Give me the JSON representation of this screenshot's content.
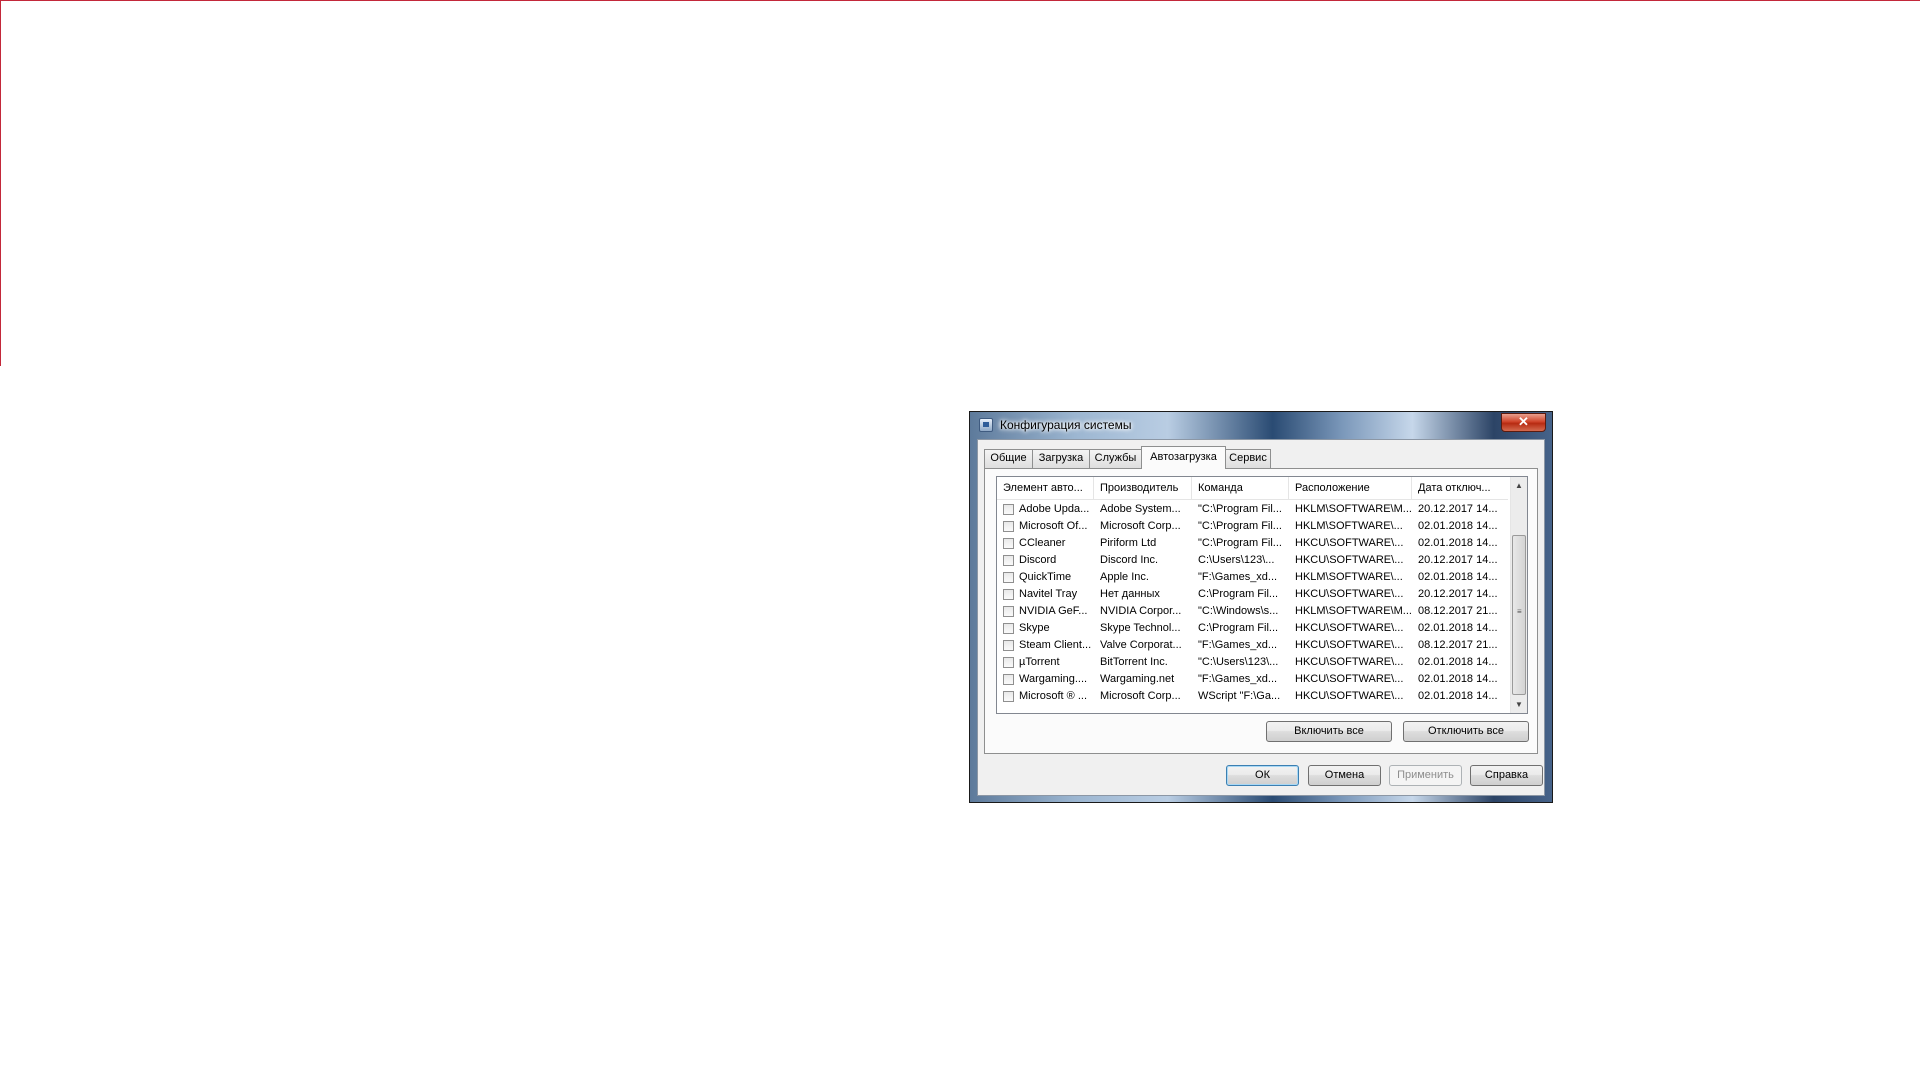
{
  "window": {
    "title": "Конфигурация системы",
    "close_glyph": "✕"
  },
  "tabs": [
    {
      "label": "Общие"
    },
    {
      "label": "Загрузка"
    },
    {
      "label": "Службы"
    },
    {
      "label": "Автозагрузка",
      "active": true
    },
    {
      "label": "Сервис"
    }
  ],
  "list": {
    "columns": [
      "Элемент авто...",
      "Производитель",
      "Команда",
      "Расположение",
      "Дата отключ..."
    ],
    "rows": [
      [
        "Adobe Upda...",
        "Adobe System...",
        "\"C:\\Program Fil...",
        "HKLM\\SOFTWARE\\M...",
        "20.12.2017 14..."
      ],
      [
        "Microsoft Of...",
        "Microsoft Corp...",
        "\"C:\\Program Fil...",
        "HKLM\\SOFTWARE\\...",
        "02.01.2018 14..."
      ],
      [
        "CCleaner",
        "Piriform Ltd",
        "\"C:\\Program Fil...",
        "HKCU\\SOFTWARE\\...",
        "02.01.2018 14..."
      ],
      [
        "Discord",
        "Discord Inc.",
        "C:\\Users\\123\\...",
        "HKCU\\SOFTWARE\\...",
        "20.12.2017 14..."
      ],
      [
        "QuickTime",
        "Apple Inc.",
        "\"F:\\Games_xd...",
        "HKLM\\SOFTWARE\\...",
        "02.01.2018 14..."
      ],
      [
        "Navitel Tray",
        "Нет данных",
        "C:\\Program Fil...",
        "HKCU\\SOFTWARE\\...",
        "20.12.2017 14..."
      ],
      [
        "NVIDIA GeF...",
        "NVIDIA Corpor...",
        "\"C:\\Windows\\s...",
        "HKLM\\SOFTWARE\\M...",
        "08.12.2017 21..."
      ],
      [
        "Skype",
        "Skype Technol...",
        "C:\\Program Fil...",
        "HKCU\\SOFTWARE\\...",
        "02.01.2018 14..."
      ],
      [
        "Steam Client...",
        "Valve Corporat...",
        "\"F:\\Games_xd...",
        "HKCU\\SOFTWARE\\...",
        "08.12.2017 21..."
      ],
      [
        "µTorrent",
        "BitTorrent Inc.",
        "\"C:\\Users\\123\\...",
        "HKCU\\SOFTWARE\\...",
        "02.01.2018 14..."
      ],
      [
        "Wargaming....",
        "Wargaming.net",
        "\"F:\\Games_xd...",
        "HKCU\\SOFTWARE\\...",
        "02.01.2018 14..."
      ],
      [
        "Microsoft ® ...",
        "Microsoft Corp...",
        "WScript \"F:\\Ga...",
        "HKCU\\SOFTWARE\\...",
        "02.01.2018 14..."
      ]
    ]
  },
  "panel_buttons": {
    "enable_all": "Включить все",
    "disable_all": "Отключить все"
  },
  "dialog_buttons": {
    "ok": "ОК",
    "cancel": "Отмена",
    "apply": "Применить",
    "help": "Справка"
  },
  "colors": {
    "frame_red": "#c3283a",
    "close_red": "#c7371c"
  }
}
